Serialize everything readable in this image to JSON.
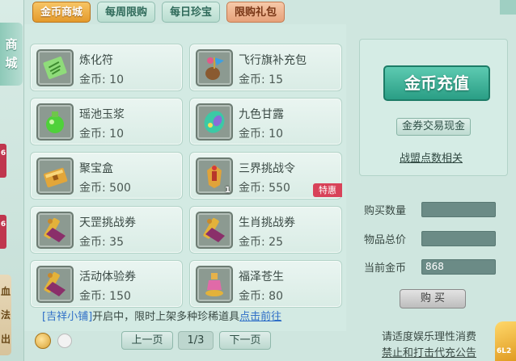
{
  "side": {
    "label_chars": [
      "商",
      "城"
    ],
    "badge_1": "6",
    "badge_2": "6",
    "lower_chars": [
      "血",
      "法",
      "出"
    ]
  },
  "tabs": [
    {
      "label": "金币商城",
      "active": true
    },
    {
      "label": "每周限购",
      "active": false
    },
    {
      "label": "每日珍宝",
      "active": false
    },
    {
      "label": "限购礼包",
      "active": false
    }
  ],
  "items": [
    {
      "name": "炼化符",
      "price": "金币: 10",
      "icon": "talisman-icon"
    },
    {
      "name": "飞行旗补充包",
      "price": "金币: 15",
      "icon": "flag-pack-icon"
    },
    {
      "name": "瑶池玉浆",
      "price": "金币: 10",
      "icon": "jade-potion-icon"
    },
    {
      "name": "九色甘露",
      "price": "金币: 10",
      "icon": "dew-gem-icon"
    },
    {
      "name": "聚宝盒",
      "price": "金币: 500",
      "icon": "treasure-box-icon"
    },
    {
      "name": "三界挑战令",
      "price": "金币: 550",
      "icon": "token-icon",
      "count": "1",
      "badge": "特惠"
    },
    {
      "name": "天罡挑战券",
      "price": "金币: 35",
      "icon": "scroll-icon"
    },
    {
      "name": "生肖挑战券",
      "price": "金币: 25",
      "icon": "scroll-icon"
    },
    {
      "name": "活动体验券",
      "price": "金币: 150",
      "icon": "scroll-icon"
    },
    {
      "name": "福泽苍生",
      "price": "金币: 80",
      "icon": "lamp-icon"
    }
  ],
  "notice": {
    "tag": "[吉祥小铺]",
    "text": "开启中，限时上架多种珍稀道具",
    "link": "点击前往"
  },
  "pager": {
    "prev": "上一页",
    "page": "1/3",
    "next": "下一页"
  },
  "right": {
    "recharge": "金币充值",
    "trade": "金券交易现金",
    "alliance": "战盟点数相关",
    "buy_qty_label": "购买数量",
    "total_label": "物品总价",
    "current_coins_label": "当前金币",
    "buy_qty_value": "",
    "total_value": "",
    "current_coins_value": "868",
    "buy": "购 买"
  },
  "footer": {
    "line1": "请适度娱乐理性消费",
    "line2": "禁止和打击代充公告",
    "corner_num": "6L2"
  },
  "colors": {
    "tab_active": "#e49a2b",
    "recharge_green": "#2a9e85",
    "badge_red": "#d84259",
    "link_blue": "#2f6fc7"
  }
}
